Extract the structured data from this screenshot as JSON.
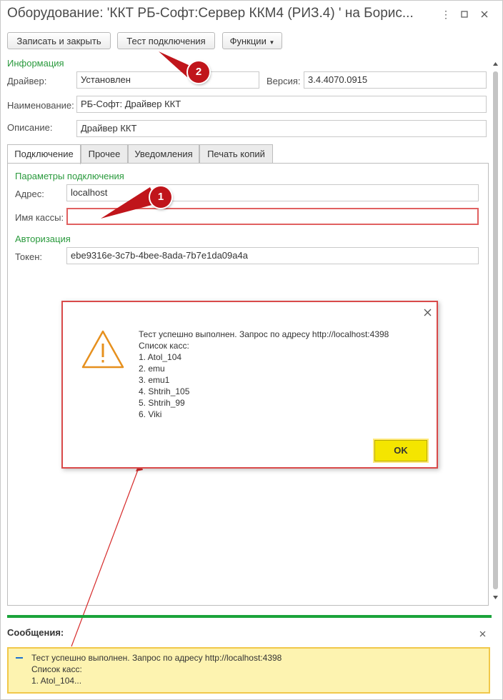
{
  "window": {
    "title": "Оборудование: 'ККТ РБ-Софт:Сервер ККМ4 (РИЗ.4) ' на Борис..."
  },
  "toolbar": {
    "save_close": "Записать и закрыть",
    "test_connection": "Тест подключения",
    "functions": "Функции"
  },
  "info": {
    "section": "Информация",
    "driver_label": "Драйвер:",
    "driver_value": "Установлен",
    "version_label": "Версия:",
    "version_value": "3.4.4070.0915",
    "name_label": "Наименование:",
    "name_value": "РБ-Софт: Драйвер ККТ",
    "desc_label": "Описание:",
    "desc_value": "Драйвер ККТ"
  },
  "tabs": [
    "Подключение",
    "Прочее",
    "Уведомления",
    "Печать копий"
  ],
  "connection": {
    "section": "Параметры подключения",
    "address_label": "Адрес:",
    "address_value": "localhost",
    "cashbox_label": "Имя кассы:",
    "cashbox_value": "",
    "auth_section": "Авторизация",
    "token_label": "Токен:",
    "token_value": "ebe9316e-3c7b-4bee-8ada-7b7e1da09a4a"
  },
  "callouts": {
    "one": "1",
    "two": "2"
  },
  "dialog": {
    "line1": "Тест успешно выполнен. Запрос по адресу http://localhost:4398",
    "list_title": "Список касс:",
    "items": [
      "1. Atol_104",
      "2. emu",
      "3. emu1",
      "4. Shtrih_105",
      "5. Shtrih_99",
      "6. Viki"
    ],
    "ok": "OK"
  },
  "messages": {
    "title": "Сообщения:",
    "line1": "Тест успешно выполнен. Запрос по адресу http://localhost:4398",
    "line2": "Список касс:",
    "line3": "1. Atol_104..."
  },
  "colors": {
    "accent_green": "#2a9a3d",
    "callout_red": "#c0151b",
    "ok_yellow": "#f4e500",
    "warning_orange": "#e6901e"
  }
}
